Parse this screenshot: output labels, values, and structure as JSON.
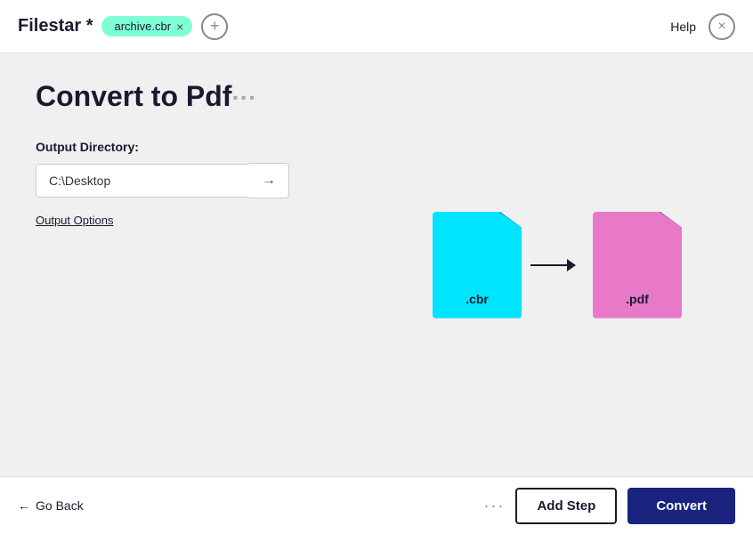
{
  "app": {
    "title": "Filestar *"
  },
  "header": {
    "file_tag": "archive.cbr",
    "help_label": "Help",
    "close_icon": "×"
  },
  "main": {
    "page_title": "Convert to Pdf",
    "page_title_dots": "...",
    "output_label": "Output Directory:",
    "output_value": "C:\\Desktop",
    "output_options_label": "Output Options",
    "illustration": {
      "source_ext": ".cbr",
      "target_ext": ".pdf"
    }
  },
  "footer": {
    "go_back_label": "Go Back",
    "more_dots": "···",
    "add_step_label": "Add Step",
    "convert_label": "Convert"
  }
}
